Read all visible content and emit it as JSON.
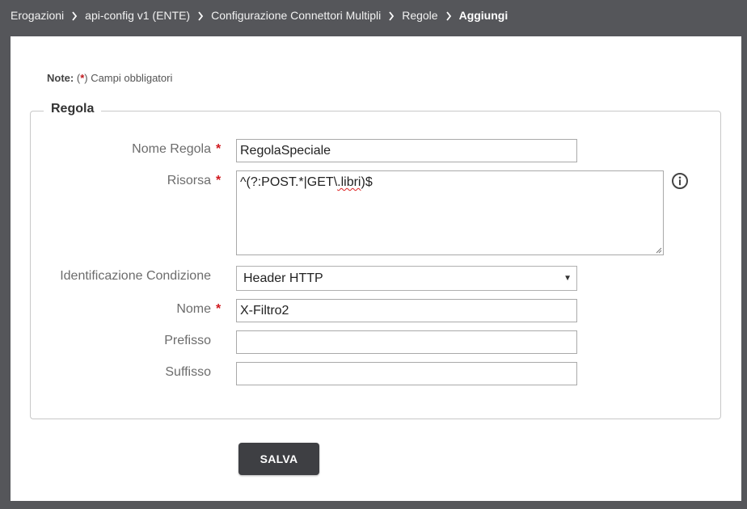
{
  "breadcrumb": {
    "items": [
      "Erogazioni",
      "api-config v1 (ENTE)",
      "Configurazione Connettori Multipli",
      "Regole"
    ],
    "current": "Aggiungi"
  },
  "note": {
    "label": "Note:",
    "open": "(",
    "star": "*",
    "text": ") Campi obbligatori"
  },
  "form": {
    "legend": "Regola",
    "required_mark": "*",
    "nome_regola": {
      "label": "Nome Regola",
      "value": "RegolaSpeciale"
    },
    "risorsa": {
      "label": "Risorsa",
      "value_prefix": "^(?:POST.*|GET\\",
      "value_error": ".libri",
      "value_suffix": ")$"
    },
    "identificazione": {
      "label": "Identificazione Condizione",
      "selected": "Header HTTP"
    },
    "nome": {
      "label": "Nome",
      "value": "X-Filtro2"
    },
    "prefisso": {
      "label": "Prefisso",
      "value": ""
    },
    "suffisso": {
      "label": "Suffisso",
      "value": ""
    }
  },
  "actions": {
    "save_label": "SALVA"
  },
  "icons": {
    "separator": "chevron-right-icon",
    "info": "info-icon"
  },
  "colors": {
    "header_bg": "#55565a",
    "required": "#d0181e",
    "button_bg": "#3e3f43"
  }
}
